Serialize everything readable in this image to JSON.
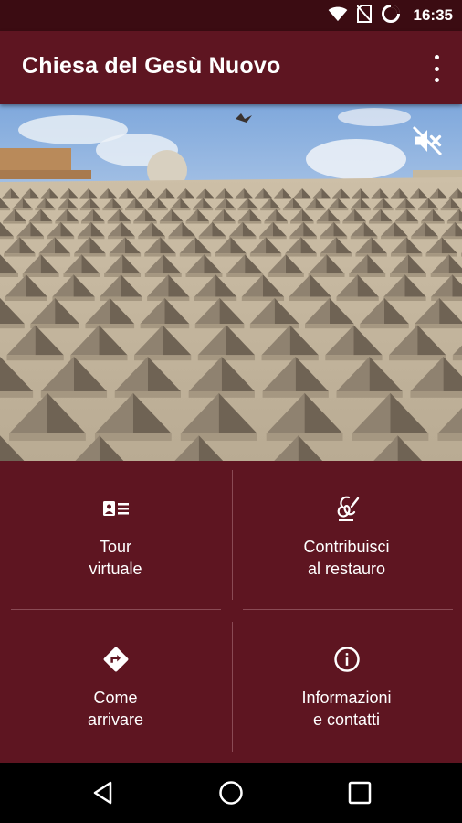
{
  "status_bar": {
    "time": "16:35",
    "icons": [
      "wifi-icon",
      "no-sim-icon",
      "battery-icon"
    ]
  },
  "app_bar": {
    "title": "Chiesa del Gesù Nuovo",
    "menu_icon": "more-vert-icon"
  },
  "hero": {
    "mute_icon": "volume-off-icon"
  },
  "tiles": [
    {
      "line1": "Tour",
      "line2": "virtuale",
      "icon": "tour-card-icon"
    },
    {
      "line1": "Contribuisci",
      "line2": "al restauro",
      "icon": "signature-icon"
    },
    {
      "line1": "Come",
      "line2": "arrivare",
      "icon": "directions-icon"
    },
    {
      "line1": "Informazioni",
      "line2": "e contatti",
      "icon": "info-icon"
    }
  ],
  "nav_bar": {
    "icons": [
      "back-icon",
      "home-icon",
      "recents-icon"
    ]
  },
  "colors": {
    "primary": "#5e1521",
    "status_bar": "#3b0c12",
    "divider": "#8a4a55"
  }
}
